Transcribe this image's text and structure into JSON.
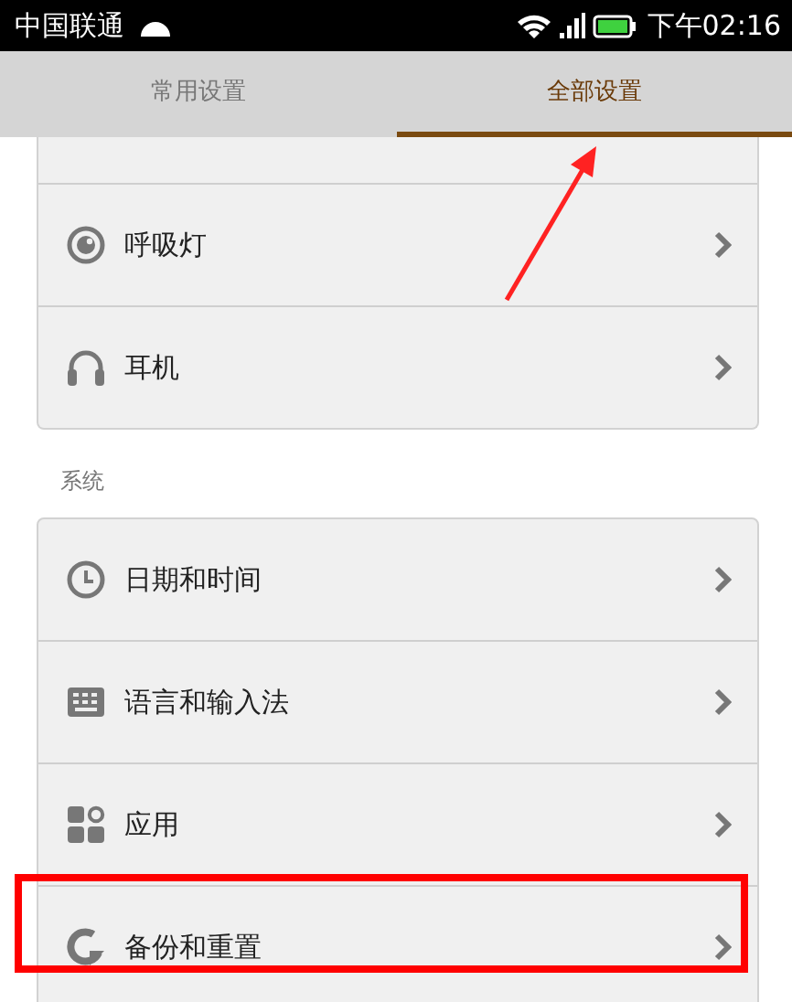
{
  "status_bar": {
    "carrier": "中国联通",
    "time": "下午02:16"
  },
  "tabs": [
    {
      "label": "常用设置",
      "selected": false,
      "pointed": false
    },
    {
      "label": "全部设置",
      "selected": true,
      "pointed": true
    }
  ],
  "sections": [
    {
      "items": [
        {
          "kind": "light",
          "label": "呼吸灯",
          "highlighted": false
        },
        {
          "kind": "headphones",
          "label": "耳机",
          "highlighted": false
        }
      ]
    },
    {
      "title": "系统",
      "items": [
        {
          "kind": "clock",
          "label": "日期和时间",
          "highlighted": false
        },
        {
          "kind": "keyboard",
          "label": "语言和输入法",
          "highlighted": false
        },
        {
          "kind": "apps",
          "label": "应用",
          "highlighted": false
        },
        {
          "kind": "reset",
          "label": "备份和重置",
          "highlighted": true
        }
      ]
    }
  ]
}
